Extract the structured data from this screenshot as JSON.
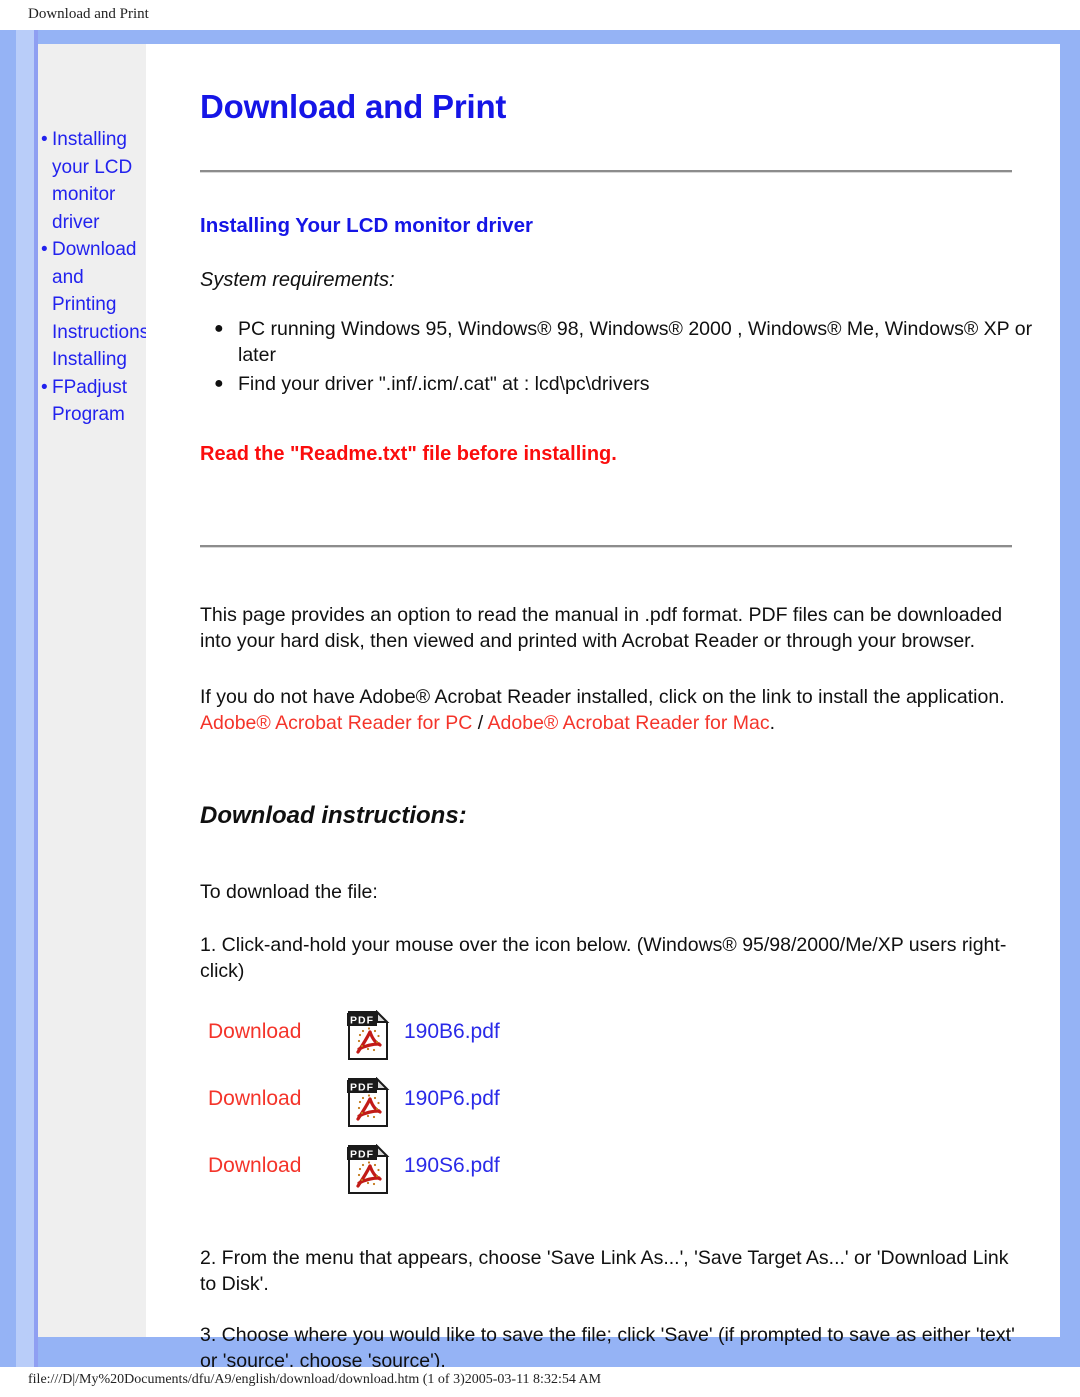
{
  "print_header": {
    "title": "Download and Print"
  },
  "print_footer": {
    "path_text": "file:///D|/My%20Documents/dfu/A9/english/download/download.htm (1 of 3)2005-03-11 8:32:54 AM"
  },
  "colors": {
    "frame_blue": "#95b3f5",
    "frame_blue_light": "#b9cdf9",
    "sidebar_gray": "#efefef",
    "heading_blue": "#1515e6",
    "link_blue": "#2222ee",
    "link_red": "#f4342a",
    "warning_red": "#fb0d0d",
    "rule_gray": "#8c8c8c"
  },
  "sidebar": {
    "items": [
      {
        "bullet": "•",
        "label": "Installing your LCD monitor driver"
      },
      {
        "bullet": "•",
        "label": "Download and Printing Instructions Installing"
      },
      {
        "bullet": "•",
        "label": "FPadjust Program"
      }
    ]
  },
  "main": {
    "page_title": "Download and Print",
    "section_heading": "Installing Your LCD monitor driver",
    "system_requirements_label": "System requirements:",
    "requirements": [
      {
        "bullet": "●",
        "text": "PC running Windows 95, Windows® 98, Windows® 2000 , Windows® Me, Windows® XP or later"
      },
      {
        "bullet": "●",
        "text": "Find your driver \".inf/.icm/.cat\" at : lcd\\pc\\drivers"
      }
    ],
    "readme_warning": "Read the \"Readme.txt\" file before installing.",
    "paragraph_intro": "This page provides an option to read the manual in .pdf format. PDF files can be downloaded into your hard disk, then viewed and printed with Acrobat Reader or through your browser.",
    "paragraph_acrobat_lead": "If you do not have Adobe® Acrobat Reader installed, click on the link to install the application.",
    "acrobat_link_pc": "Adobe® Acrobat Reader for PC",
    "acrobat_link_separator": " / ",
    "acrobat_link_mac": "Adobe® Acrobat Reader for Mac",
    "acrobat_link_trailing": ".",
    "download_instructions_heading": "Download instructions:",
    "step_intro": "To download the file:",
    "step_1": "1. Click-and-hold your mouse over the icon below. (Windows® 95/98/2000/Me/XP users right-click)",
    "step_2": "2. From the menu that appears, choose 'Save Link As...', 'Save Target As...' or 'Download Link to Disk'.",
    "step_3": "3. Choose where you would like to save the file; click 'Save' (if prompted to save as either 'text' or 'source', choose 'source').",
    "downloads": [
      {
        "link_label": "Download",
        "icon": "pdf-file-icon",
        "icon_label": "PDF",
        "file_name": "190B6.pdf"
      },
      {
        "link_label": "Download",
        "icon": "pdf-file-icon",
        "icon_label": "PDF",
        "file_name": "190P6.pdf"
      },
      {
        "link_label": "Download",
        "icon": "pdf-file-icon",
        "icon_label": "PDF",
        "file_name": "190S6.pdf"
      }
    ]
  }
}
